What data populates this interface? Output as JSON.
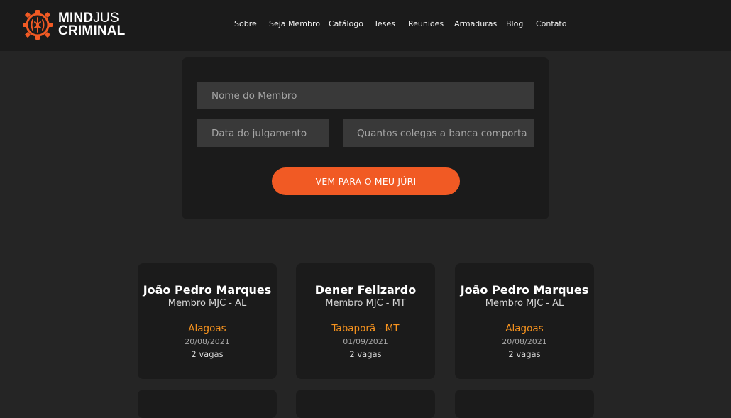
{
  "brand": {
    "line1_bold": "MIND",
    "line1_thin": "JUS",
    "line2": "CRIMINAL",
    "accent": "#f15a24"
  },
  "nav": {
    "items": [
      {
        "label": "Sobre"
      },
      {
        "label": "Seja Membro"
      },
      {
        "label": "Catálogo"
      },
      {
        "label": "Teses"
      },
      {
        "label": "Reuniões"
      },
      {
        "label": "Armaduras"
      },
      {
        "label": "Blog"
      },
      {
        "label": "Contato"
      }
    ]
  },
  "form": {
    "member_placeholder": "Nome do Membro",
    "date_placeholder": "Data do julgamento",
    "colleagues_placeholder": "Quantos colegas a banca comporta",
    "submit_label": "VEM PARA O MEU JÚRI"
  },
  "cards": [
    {
      "name": "João Pedro Marques",
      "role": "Membro MJC - AL",
      "city": "Alagoas",
      "date": "20/08/2021",
      "vagas": "2 vagas"
    },
    {
      "name": "Dener Felizardo",
      "role": "Membro MJC - MT",
      "city": "Tabaporã - MT",
      "date": "01/09/2021",
      "vagas": "2 vagas"
    },
    {
      "name": "João Pedro Marques",
      "role": "Membro MJC - AL",
      "city": "Alagoas",
      "date": "20/08/2021",
      "vagas": "2 vagas"
    }
  ],
  "colors": {
    "background": "#252525",
    "panel": "#1b1b1b",
    "input": "#393939",
    "accent": "#f15a24",
    "city": "#f7931e"
  }
}
